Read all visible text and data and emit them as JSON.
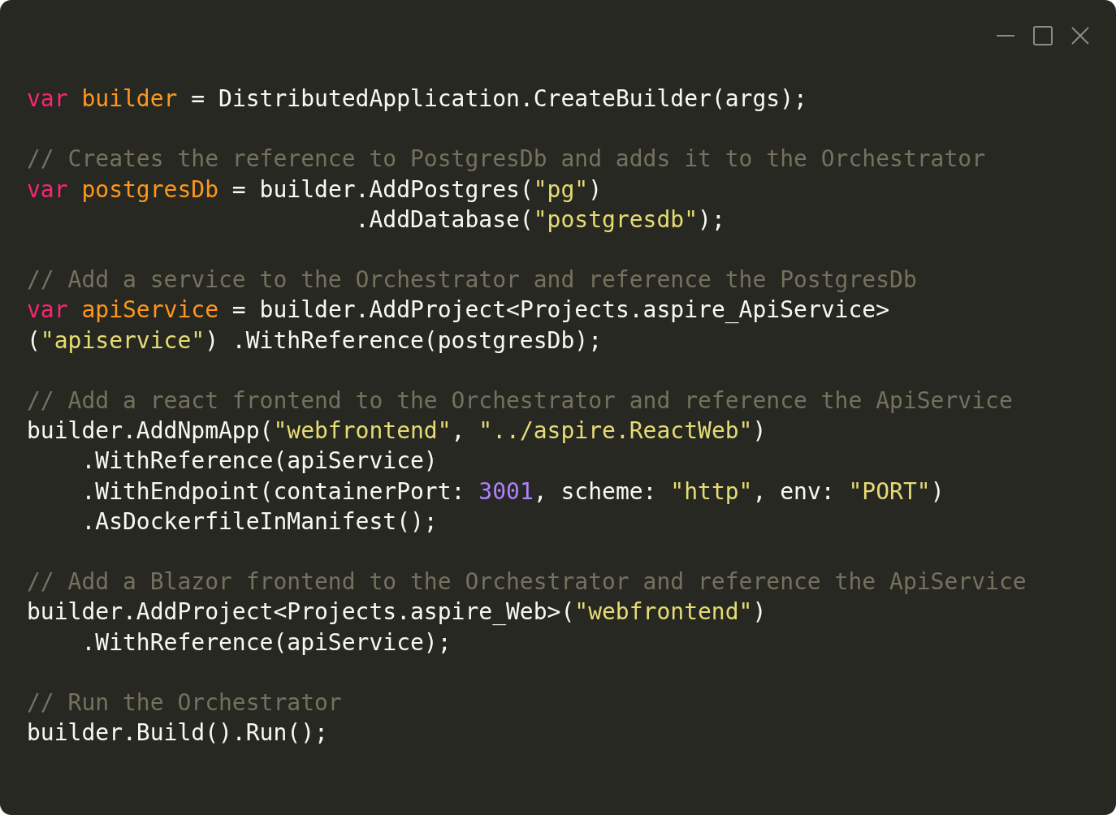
{
  "window_controls": [
    {
      "kind": "minimize"
    },
    {
      "kind": "maximize"
    },
    {
      "kind": "close"
    }
  ],
  "code_blocks": [
    [
      {
        "kind": "code",
        "tokens": [
          {
            "kind": "keyword",
            "text": "var "
          },
          {
            "kind": "variable",
            "text": "builder"
          },
          {
            "kind": "plain",
            "text": " = DistributedApplication.CreateBuilder(args);"
          }
        ]
      }
    ],
    [
      {
        "kind": "comment",
        "text": "// Creates the reference to PostgresDb and adds it to the Orchestrator"
      },
      {
        "kind": "code",
        "tokens": [
          {
            "kind": "keyword",
            "text": "var "
          },
          {
            "kind": "variable",
            "text": "postgresDb"
          },
          {
            "kind": "plain",
            "text": " = builder.AddPostgres("
          },
          {
            "kind": "string",
            "text": "\"pg\""
          },
          {
            "kind": "plain",
            "text": ")"
          }
        ]
      },
      {
        "kind": "code",
        "tokens": [
          {
            "kind": "plain",
            "text": "                        .AddDatabase("
          },
          {
            "kind": "string",
            "text": "\"postgresdb\""
          },
          {
            "kind": "plain",
            "text": ");"
          }
        ]
      }
    ],
    [
      {
        "kind": "comment",
        "text": "// Add a service to the Orchestrator and reference the PostgresDb"
      },
      {
        "kind": "code",
        "tokens": [
          {
            "kind": "keyword",
            "text": "var "
          },
          {
            "kind": "variable",
            "text": "apiService"
          },
          {
            "kind": "plain",
            "text": " = builder.AddProject<Projects.aspire_ApiService>"
          }
        ]
      },
      {
        "kind": "split",
        "segments": [
          {
            "tokens": [
              {
                "kind": "plain",
                "text": "("
              },
              {
                "kind": "string",
                "text": "\"apiservice\""
              },
              {
                "kind": "plain",
                "text": ")"
              }
            ]
          },
          {
            "tokens": [
              {
                "kind": "plain",
                "text": ".WithReference(postgresDb);"
              }
            ]
          }
        ]
      }
    ],
    [
      {
        "kind": "comment",
        "text": "// Add a react frontend to the Orchestrator and reference the ApiService"
      },
      {
        "kind": "code",
        "tokens": [
          {
            "kind": "plain",
            "text": "builder.AddNpmApp("
          },
          {
            "kind": "string",
            "text": "\"webfrontend\""
          },
          {
            "kind": "plain",
            "text": ", "
          },
          {
            "kind": "string",
            "text": "\"../aspire.ReactWeb\""
          },
          {
            "kind": "plain",
            "text": ")"
          }
        ]
      },
      {
        "kind": "code",
        "tokens": [
          {
            "kind": "plain",
            "text": "    .WithReference(apiService)"
          }
        ]
      },
      {
        "kind": "code",
        "tokens": [
          {
            "kind": "plain",
            "text": "    .WithEndpoint(containerPort: "
          },
          {
            "kind": "number",
            "text": "3001"
          },
          {
            "kind": "plain",
            "text": ", scheme: "
          },
          {
            "kind": "string",
            "text": "\"http\""
          },
          {
            "kind": "plain",
            "text": ", env: "
          },
          {
            "kind": "string",
            "text": "\"PORT\""
          },
          {
            "kind": "plain",
            "text": ")"
          }
        ]
      },
      {
        "kind": "code",
        "tokens": [
          {
            "kind": "plain",
            "text": "    .AsDockerfileInManifest();"
          }
        ]
      }
    ],
    [
      {
        "kind": "comment",
        "text": "// Add a Blazor frontend to the Orchestrator and reference the ApiService"
      },
      {
        "kind": "code",
        "tokens": [
          {
            "kind": "plain",
            "text": "builder.AddProject<Projects.aspire_Web>("
          },
          {
            "kind": "string",
            "text": "\"webfrontend\""
          },
          {
            "kind": "plain",
            "text": ")"
          }
        ]
      },
      {
        "kind": "code",
        "tokens": [
          {
            "kind": "plain",
            "text": "    .WithReference(apiService);"
          }
        ]
      }
    ],
    [
      {
        "kind": "comment",
        "text": "// Run the Orchestrator"
      },
      {
        "kind": "code",
        "tokens": [
          {
            "kind": "plain",
            "text": "builder.Build().Run();"
          }
        ]
      }
    ]
  ]
}
